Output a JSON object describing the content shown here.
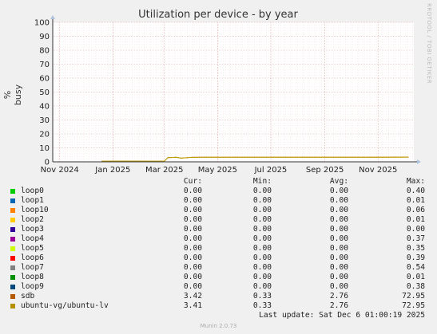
{
  "chart_data": {
    "type": "line",
    "title": "Utilization per device - by year",
    "ylabel": "% busy",
    "ylim": [
      0,
      100
    ],
    "y_ticks": [
      "0",
      "10",
      "20",
      "30",
      "40",
      "50",
      "60",
      "70",
      "80",
      "90",
      "100"
    ],
    "x_ticks": [
      "Nov 2024",
      "Jan 2025",
      "Mar 2025",
      "May 2025",
      "Jul 2025",
      "Sep 2025",
      "Nov 2025"
    ],
    "series": [
      {
        "name": "sdb",
        "color": "#cc6600",
        "x": [
          "2024-12-19",
          "2025-01-10",
          "2025-02-15",
          "2025-03-01",
          "2025-03-05",
          "2025-03-15",
          "2025-03-20",
          "2025-04-01",
          "2025-05-01",
          "2025-06-01",
          "2025-07-01",
          "2025-08-01",
          "2025-09-01",
          "2025-10-01",
          "2025-11-01",
          "2025-12-06"
        ],
        "y": [
          0.4,
          0.5,
          0.4,
          0.4,
          3.0,
          3.3,
          2.6,
          3.2,
          3.3,
          3.3,
          3.3,
          3.3,
          3.3,
          3.3,
          3.3,
          3.4
        ]
      },
      {
        "name": "ubuntu-vg/ubuntu-lv",
        "color": "#b8a000",
        "x": [
          "2024-12-19",
          "2025-01-10",
          "2025-02-15",
          "2025-03-01",
          "2025-03-05",
          "2025-03-15",
          "2025-03-20",
          "2025-04-01",
          "2025-05-01",
          "2025-06-01",
          "2025-07-01",
          "2025-08-01",
          "2025-09-01",
          "2025-10-01",
          "2025-11-01",
          "2025-12-06"
        ],
        "y": [
          0.4,
          0.5,
          0.4,
          0.4,
          3.0,
          3.2,
          2.6,
          3.2,
          3.3,
          3.3,
          3.3,
          3.3,
          3.3,
          3.3,
          3.3,
          3.4
        ]
      }
    ],
    "legend_headers": {
      "cur": "Cur:",
      "min": "Min:",
      "avg": "Avg:",
      "max": "Max:"
    },
    "legend": [
      {
        "name": "loop0",
        "color": "#00cc00",
        "cur": "0.00",
        "min": "0.00",
        "avg": "0.00",
        "max": "0.40"
      },
      {
        "name": "loop1",
        "color": "#0066b3",
        "cur": "0.00",
        "min": "0.00",
        "avg": "0.00",
        "max": "0.01"
      },
      {
        "name": "loop10",
        "color": "#ff8000",
        "cur": "0.00",
        "min": "0.00",
        "avg": "0.00",
        "max": "0.06"
      },
      {
        "name": "loop2",
        "color": "#ffcc00",
        "cur": "0.00",
        "min": "0.00",
        "avg": "0.00",
        "max": "0.01"
      },
      {
        "name": "loop3",
        "color": "#330099",
        "cur": "0.00",
        "min": "0.00",
        "avg": "0.00",
        "max": "0.00"
      },
      {
        "name": "loop4",
        "color": "#990099",
        "cur": "0.00",
        "min": "0.00",
        "avg": "0.00",
        "max": "0.37"
      },
      {
        "name": "loop5",
        "color": "#ccff00",
        "cur": "0.00",
        "min": "0.00",
        "avg": "0.00",
        "max": "0.35"
      },
      {
        "name": "loop6",
        "color": "#ff0000",
        "cur": "0.00",
        "min": "0.00",
        "avg": "0.00",
        "max": "0.39"
      },
      {
        "name": "loop7",
        "color": "#808080",
        "cur": "0.00",
        "min": "0.00",
        "avg": "0.00",
        "max": "0.54"
      },
      {
        "name": "loop8",
        "color": "#008f00",
        "cur": "0.00",
        "min": "0.00",
        "avg": "0.00",
        "max": "0.01"
      },
      {
        "name": "loop9",
        "color": "#00487d",
        "cur": "0.00",
        "min": "0.00",
        "avg": "0.00",
        "max": "0.38"
      },
      {
        "name": "sdb",
        "color": "#b35a00",
        "cur": "3.42",
        "min": "0.33",
        "avg": "2.76",
        "max": "72.95"
      },
      {
        "name": "ubuntu-vg/ubuntu-lv",
        "color": "#b38f00",
        "cur": "3.41",
        "min": "0.33",
        "avg": "2.76",
        "max": "72.95"
      }
    ]
  },
  "side_credit": "RRDTOOL / TOBI OETIKER",
  "last_update": "Last update: Sat Dec  6 01:00:19 2025",
  "footer": "Munin 2.0.73"
}
